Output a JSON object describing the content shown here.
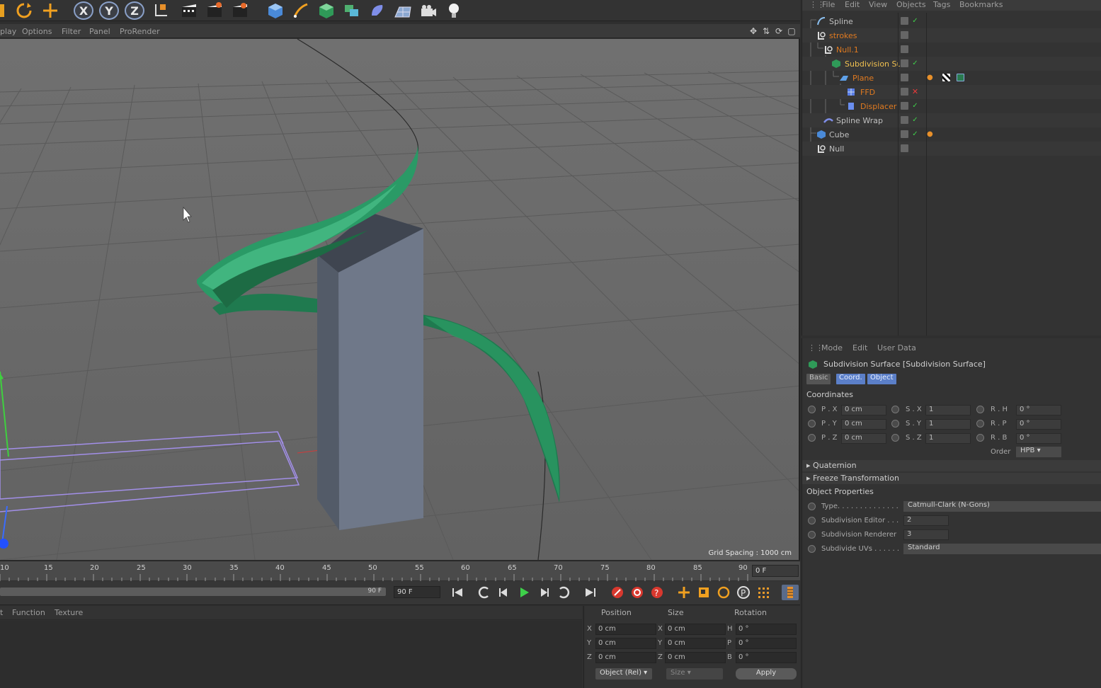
{
  "viewport_menu": {
    "items": [
      "play",
      "Options",
      "Filter",
      "Panel",
      "ProRender"
    ]
  },
  "viewport": {
    "grid_spacing": "Grid Spacing : 1000 cm"
  },
  "timeline": {
    "ticks": [
      "10",
      "15",
      "20",
      "25",
      "30",
      "35",
      "40",
      "45",
      "50",
      "55",
      "60",
      "65",
      "70",
      "75",
      "80",
      "85",
      "90"
    ],
    "current_frame": "0 F",
    "range_end": "90 F",
    "end_frame": "90 F"
  },
  "material_menu": {
    "items": [
      "t",
      "Function",
      "Texture"
    ]
  },
  "coord_manager": {
    "headers": {
      "position": "Position",
      "size": "Size",
      "rotation": "Rotation"
    },
    "rows": [
      {
        "pos_axis": "X",
        "pos": "0 cm",
        "size_axis": "X",
        "size": "0 cm",
        "rot_axis": "H",
        "rot": "0 °"
      },
      {
        "pos_axis": "Y",
        "pos": "0 cm",
        "size_axis": "Y",
        "size": "0 cm",
        "rot_axis": "P",
        "rot": "0 °"
      },
      {
        "pos_axis": "Z",
        "pos": "0 cm",
        "size_axis": "Z",
        "size": "0 cm",
        "rot_axis": "B",
        "rot": "0 °"
      }
    ],
    "mode_select": "Object (Rel)",
    "size_select": "Size",
    "apply_label": "Apply"
  },
  "object_manager": {
    "menu": [
      "File",
      "Edit",
      "View",
      "Objects",
      "Tags",
      "Bookmarks"
    ],
    "objects": [
      {
        "name": "Spline",
        "style": "gray"
      },
      {
        "name": "strokes",
        "style": "orange"
      },
      {
        "name": "Null.1",
        "style": "orange"
      },
      {
        "name": "Subdivision Su",
        "style": "sel"
      },
      {
        "name": "Plane",
        "style": "orange"
      },
      {
        "name": "FFD",
        "style": "orange"
      },
      {
        "name": "Displacer",
        "style": "orange"
      },
      {
        "name": "Spline Wrap",
        "style": "gray"
      },
      {
        "name": "Cube",
        "style": "gray"
      },
      {
        "name": "Null",
        "style": "gray"
      }
    ]
  },
  "attribute_manager": {
    "menu": [
      "Mode",
      "Edit",
      "User Data"
    ],
    "title": "Subdivision Surface [Subdivision Surface]",
    "tabs": [
      "Basic",
      "Coord.",
      "Object"
    ],
    "coordinates_label": "Coordinates",
    "coords": [
      {
        "p_label": "P . X",
        "p_val": "0 cm",
        "s_label": "S . X",
        "s_val": "1",
        "r_label": "R . H",
        "r_val": "0 °"
      },
      {
        "p_label": "P . Y",
        "p_val": "0 cm",
        "s_label": "S . Y",
        "s_val": "1",
        "r_label": "R . P",
        "r_val": "0 °"
      },
      {
        "p_label": "P . Z",
        "p_val": "0 cm",
        "s_label": "S . Z",
        "s_val": "1",
        "r_label": "R . B",
        "r_val": "0 °"
      }
    ],
    "order_label": "Order",
    "order_value": "HPB",
    "quaternion_label": "Quaternion",
    "freeze_label": "Freeze Transformation",
    "object_properties_label": "Object Properties",
    "props": {
      "type_label": "Type. . . . . . . . . . . . . .",
      "type_value": "Catmull-Clark (N-Gons)",
      "editor_label": "Subdivision Editor . . .",
      "editor_value": "2",
      "renderer_label": "Subdivision Renderer",
      "renderer_value": "3",
      "uvs_label": "Subdivide UVs . . . . . .",
      "uvs_value": "Standard"
    }
  }
}
